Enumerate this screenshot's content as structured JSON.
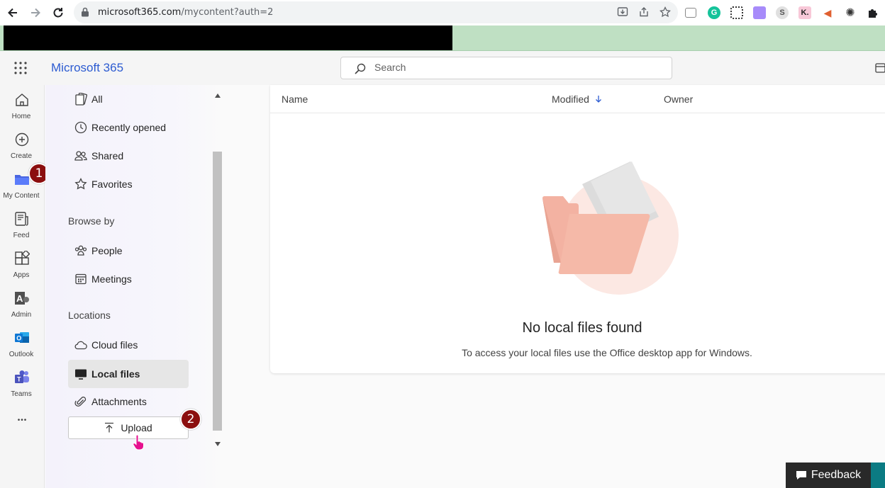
{
  "browser": {
    "url_host": "microsoft365.com",
    "url_path": "/mycontent?auth=2"
  },
  "header": {
    "brand": "Microsoft 365",
    "search_placeholder": "Search"
  },
  "rail": {
    "items": [
      {
        "label": "Home",
        "icon": "home-icon"
      },
      {
        "label": "Create",
        "icon": "plus-circle-icon"
      },
      {
        "label": "My Content",
        "icon": "folder-icon"
      },
      {
        "label": "Feed",
        "icon": "feed-icon"
      },
      {
        "label": "Apps",
        "icon": "apps-icon"
      },
      {
        "label": "Admin",
        "icon": "admin-icon"
      },
      {
        "label": "Outlook",
        "icon": "outlook-icon"
      },
      {
        "label": "Teams",
        "icon": "teams-icon"
      }
    ],
    "more": "•••"
  },
  "nav": {
    "items": [
      {
        "label": "All",
        "icon": "all-files-icon"
      },
      {
        "label": "Recently opened",
        "icon": "clock-icon"
      },
      {
        "label": "Shared",
        "icon": "shared-icon"
      },
      {
        "label": "Favorites",
        "icon": "star-icon"
      }
    ],
    "browse_heading": "Browse by",
    "browse_items": [
      {
        "label": "People",
        "icon": "people-icon"
      },
      {
        "label": "Meetings",
        "icon": "calendar-icon"
      }
    ],
    "locations_heading": "Locations",
    "location_items": [
      {
        "label": "Cloud files",
        "icon": "cloud-icon"
      },
      {
        "label": "Local files",
        "icon": "monitor-icon",
        "active": true
      },
      {
        "label": "Attachments",
        "icon": "paperclip-icon"
      }
    ],
    "upload_label": "Upload"
  },
  "table": {
    "columns": [
      "Name",
      "Modified",
      "Owner"
    ],
    "sort_column": "Modified"
  },
  "empty_state": {
    "title": "No local files found",
    "subtitle": "To access your local files use the Office desktop app for Windows."
  },
  "callouts": {
    "step1": "1",
    "step2": "2"
  },
  "feedback_label": "Feedback",
  "colors": {
    "brand": "#2c5bd1",
    "callout": "#8b0e0e",
    "folder": "#f0b6a4"
  }
}
